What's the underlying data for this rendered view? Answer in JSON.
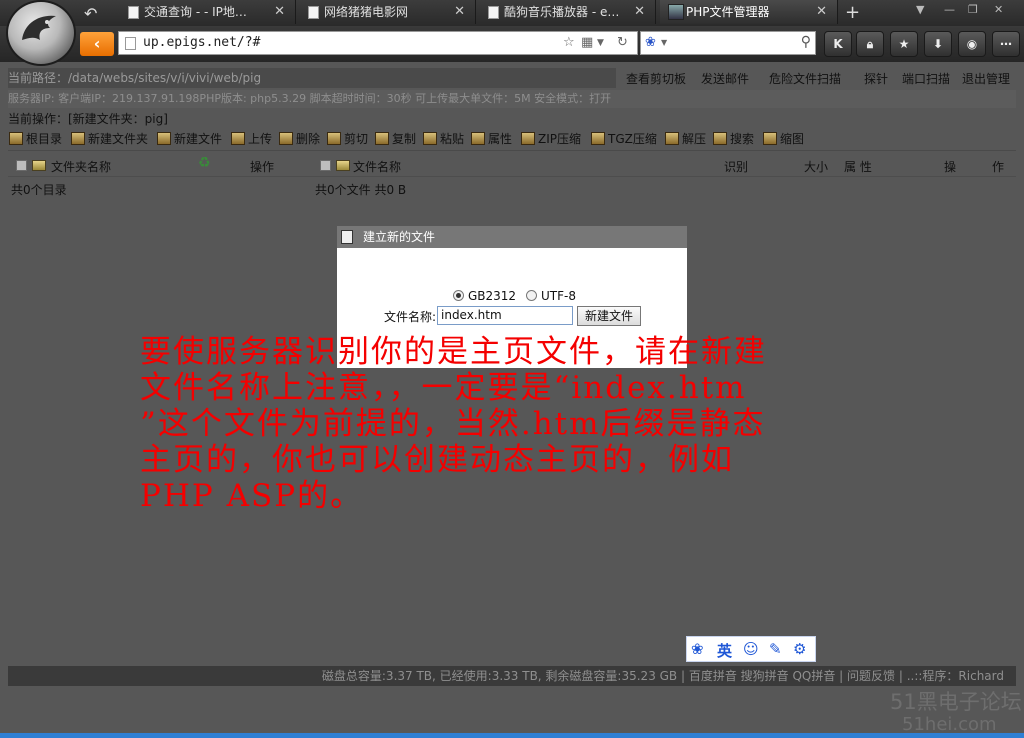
{
  "browser": {
    "tabs": [
      {
        "label": "交通查询 - - IP地…",
        "active": false
      },
      {
        "label": "网络猪猪电影网",
        "active": false
      },
      {
        "label": "酷狗音乐播放器 - e…",
        "active": false
      },
      {
        "label": "PHP文件管理器",
        "active": true
      }
    ],
    "tab_close": "✕",
    "new_tab": "+",
    "url": "up.epigs.net/?#",
    "toolbar_buttons": [
      "K",
      "lock",
      "star",
      "download",
      "gamepad",
      "menu"
    ]
  },
  "page": {
    "path_label": "当前路径：/data/webs/sites/v/i/vivi/web/pig",
    "top_menu": [
      "查看剪切板",
      "发送邮件",
      "危险文件扫描",
      "探针",
      "端口扫描",
      "退出管理"
    ],
    "server_info": "服务器IP: 客户端IP：219.137.91.198PHP版本: php5.3.29 脚本超时时间：30秒 可上传最大单文件：5M 安全模式：打开",
    "current_op": "当前操作：[新建文件夹：pig]",
    "actions": [
      "根目录",
      "新建文件夹",
      "新建文件",
      "上传",
      "删除",
      "剪切",
      "复制",
      "粘贴",
      "属性",
      "ZIP压缩",
      "TGZ压缩",
      "解压",
      "搜索",
      "缩图"
    ],
    "left_columns": {
      "name": "文件夹名称",
      "op": "操作"
    },
    "right_columns": {
      "name": "文件名称",
      "ident": "识别",
      "size": "大小",
      "attr": "属 性",
      "op1": "操",
      "op2": "作"
    },
    "left_count": "共0个目录",
    "right_count": "共0个文件 共0  B",
    "footer": "磁盘总容量:3.37 TB, 已经使用:3.33 TB, 剩余磁盘容量:35.23 GB | 百度拼音 搜狗拼音 QQ拼音 | 问题反馈 | ..::程序：Richard"
  },
  "dialog": {
    "title": "建立新的文件",
    "encodings": [
      {
        "label": "GB2312",
        "selected": true
      },
      {
        "label": "UTF-8",
        "selected": false
      }
    ],
    "filename_label": "文件名称:",
    "filename_value": "index.htm",
    "create_button": "新建文件"
  },
  "annotation": {
    "lines": [
      "要使服务器识别你的是主页文件，请在新建",
      "文件名称上注意，，一定要是“index.htm",
      "”这个文件为前提的，当然.htm后缀是静态",
      "主页的，你也可以创建动态主页的，例如",
      "PHP ASP的。"
    ],
    "color": "#f40000"
  },
  "ime": {
    "lang": "英"
  },
  "watermark": {
    "line1": "51黑电子论坛",
    "line2": "51hei.com"
  }
}
